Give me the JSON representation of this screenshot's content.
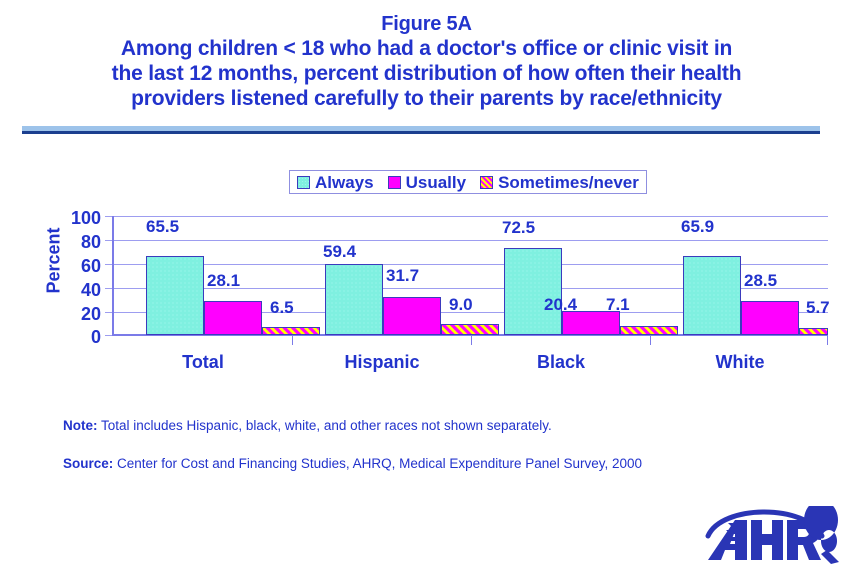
{
  "title": {
    "figure": "Figure 5A",
    "line1": "Among children < 18 who had a doctor's office or clinic visit in",
    "line2": "the last 12 months, percent distribution of how often their health",
    "line3": "providers listened carefully to their parents by race/ethnicity"
  },
  "notes": {
    "note_label": "Note:",
    "note_text": " Total includes Hispanic, black, white, and other races not shown separately.",
    "source_label": "Source:",
    "source_text": " Center for Cost and Financing Studies, AHRQ, Medical Expenditure Panel Survey, 2000"
  },
  "logo": {
    "text": "AHRQ"
  },
  "colors": {
    "text_blue": "#2233cc",
    "always": "#7ff0e0",
    "usually": "#ff00ff",
    "sometimes_base": "#ffff00",
    "sometimes_stripe": "#ff00ff",
    "gridline": "#9d9df0",
    "divider_band": "#9dc3ea",
    "divider_rule": "#1b3f8f",
    "logo_blue": "#2a35b5"
  },
  "chart_data": {
    "type": "bar",
    "title": "Among children < 18 who had a doctor's office or clinic visit in the last 12 months, percent distribution of how often their health providers listened carefully to their parents by race/ethnicity",
    "xlabel": "",
    "ylabel": "Percent",
    "ylim": [
      0,
      100
    ],
    "yticks": [
      0,
      20,
      40,
      60,
      80,
      100
    ],
    "grid": true,
    "legend_position": "top-center",
    "categories": [
      "Total",
      "Hispanic",
      "Black",
      "White"
    ],
    "series": [
      {
        "name": "Always",
        "values": [
          65.5,
          59.4,
          72.5,
          65.9
        ]
      },
      {
        "name": "Usually",
        "values": [
          28.1,
          31.7,
          20.4,
          28.5
        ]
      },
      {
        "name": "Sometimes/never",
        "values": [
          6.5,
          9.0,
          7.1,
          5.7
        ]
      }
    ],
    "value_labels": [
      [
        "65.5",
        "28.1",
        "6.5"
      ],
      [
        "59.4",
        "31.7",
        "9.0"
      ],
      [
        "72.5",
        "20.4",
        "7.1"
      ],
      [
        "65.9",
        "28.5",
        "5.7"
      ]
    ]
  }
}
